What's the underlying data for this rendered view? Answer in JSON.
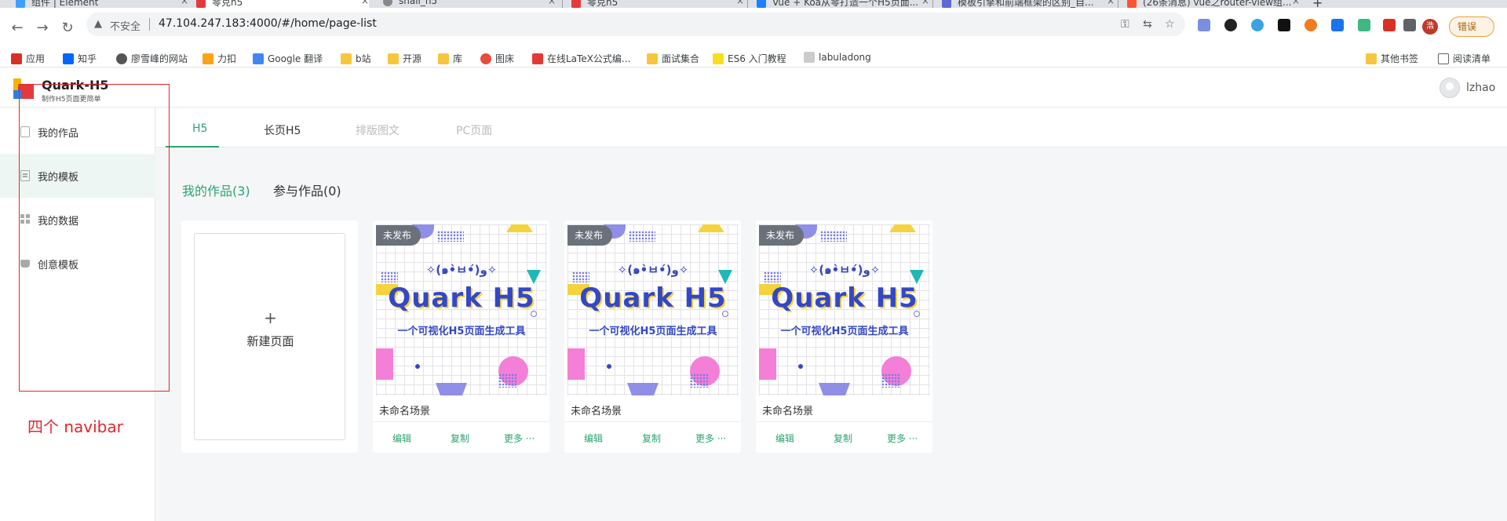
{
  "browser": {
    "tabs": [
      {
        "title": "组件 | Element"
      },
      {
        "title": "零克h5"
      },
      {
        "title": "snail_h5"
      },
      {
        "title": "零克h5"
      },
      {
        "title": "Vue + Koa从零打造一个H5页面..."
      },
      {
        "title": "模板引擎和前端框架的区别_自..."
      },
      {
        "title": "(26条消息) vue之router-view组..."
      }
    ],
    "new_tab": "+",
    "tab_close": "×",
    "address": {
      "security_label": "不安全",
      "url": "47.104.247.183:4000/#/home/page-list"
    },
    "profile_initial": "浩",
    "error_button": "错误",
    "bookmarks": [
      "应用",
      "知乎",
      "廖雪峰的网站",
      "力扣",
      "Google 翻译",
      "b站",
      "开源",
      "库",
      "图床",
      "在线LaTeX公式编...",
      "面试集合",
      "ES6 入门教程",
      "labuladong"
    ],
    "bookmarks_right": [
      "其他书签",
      "阅读清单"
    ]
  },
  "app": {
    "brand": {
      "name": "Quark-H5",
      "slogan": "制作H5页面更简单"
    },
    "user": {
      "name": "lzhao"
    },
    "sidebar": [
      {
        "label": "我的作品",
        "icon": "document-icon"
      },
      {
        "label": "我的模板",
        "icon": "template-icon"
      },
      {
        "label": "我的数据",
        "icon": "grid-icon"
      },
      {
        "label": "创意模板",
        "icon": "creative-icon"
      }
    ],
    "sidebar_active": "我的模板",
    "page_tabs": [
      {
        "label": "H5",
        "state": "active"
      },
      {
        "label": "长页H5",
        "state": "normal"
      },
      {
        "label": "排版图文",
        "state": "disabled"
      },
      {
        "label": "PC页面",
        "state": "disabled"
      }
    ],
    "sub_tabs": [
      {
        "label": "我的作品(3)",
        "state": "active"
      },
      {
        "label": "参与作品(0)",
        "state": "normal"
      }
    ],
    "new_page": {
      "icon": "+",
      "label": "新建页面"
    },
    "cards": [
      {
        "status": "未发布",
        "cover_kaomoji": "✧(๑•̀ㅂ•́)و✧",
        "cover_title": "Quark H5",
        "cover_subtitle": "一个可视化H5页面生成工具",
        "name": "未命名场景",
        "actions": {
          "edit": "编辑",
          "copy": "复制",
          "more": "更多 ···"
        }
      },
      {
        "status": "未发布",
        "cover_kaomoji": "✧(๑•̀ㅂ•́)و✧",
        "cover_title": "Quark H5",
        "cover_subtitle": "一个可视化H5页面生成工具",
        "name": "未命名场景",
        "actions": {
          "edit": "编辑",
          "copy": "复制",
          "more": "更多 ···"
        }
      },
      {
        "status": "未发布",
        "cover_kaomoji": "✧(๑•̀ㅂ•́)و✧",
        "cover_title": "Quark H5",
        "cover_subtitle": "一个可视化H5页面生成工具",
        "name": "未命名场景",
        "actions": {
          "edit": "编辑",
          "copy": "复制",
          "more": "更多 ···"
        }
      }
    ]
  },
  "annotation": {
    "text": "四个 navibar",
    "color": "#e3262e"
  },
  "colors": {
    "accent": "#2ba471",
    "annotation": "#e3262e"
  }
}
